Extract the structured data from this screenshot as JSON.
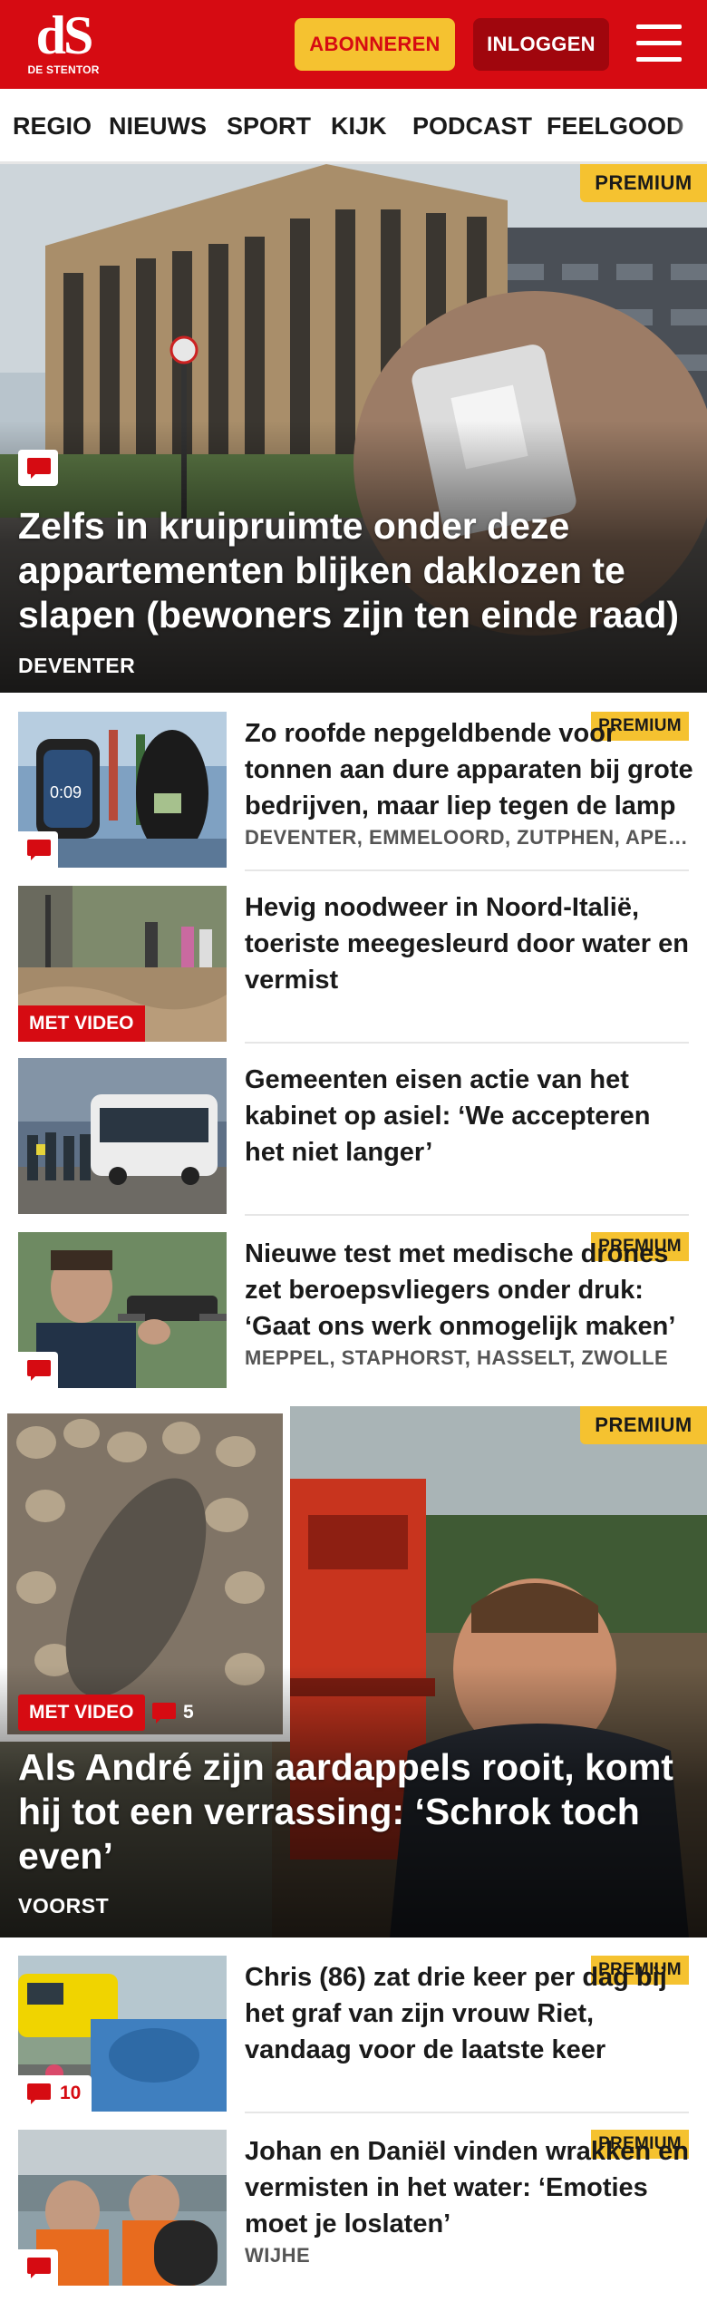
{
  "header": {
    "logo_mark": "dS",
    "logo_sub": "DE STENTOR",
    "subscribe_label": "ABONNEREN",
    "login_label": "INLOGGEN"
  },
  "nav": {
    "items": [
      "REGIO",
      "NIEUWS",
      "SPORT",
      "KIJK",
      "PODCAST",
      "FEELGOOD"
    ]
  },
  "labels": {
    "premium": "PREMIUM",
    "video": "MET VIDEO"
  },
  "hero1": {
    "title": "Zelfs in kruipruimte onder deze appartementen blijken daklozen te slapen (bewoners zijn ten einde raad)",
    "place": "DEVENTER"
  },
  "articles": [
    {
      "title": "Zo roofde nepgeldbende voor tonnen aan dure apparaten bij grote bedrijven, maar liep tegen de lamp",
      "place": "DEVENTER, EMMELOORD, ZUTPHEN, APELDOORN"
    },
    {
      "title": "Hevig noodweer in Noord-Italië, toeriste meegesleurd door water en vermist"
    },
    {
      "title": "Gemeenten eisen actie van het kabinet op asiel: ‘We accepteren het niet langer’"
    },
    {
      "title": "Nieuwe test met medische drones zet beroepsvliegers onder druk: ‘Gaat ons werk onmogelijk maken’",
      "place": "MEPPEL, STAPHORST, HASSELT, ZWOLLE"
    }
  ],
  "hero2": {
    "title": "Als André zijn aardappels rooit, komt hij tot een verrassing: ‘Schrok toch even’",
    "place": "VOORST",
    "comment_count": "5"
  },
  "articles2": [
    {
      "title": "Chris (86) zat drie keer per dag bij het graf van zijn vrouw Riet, vandaag voor de laatste keer",
      "comment_count": "10"
    },
    {
      "title": "Johan en Daniël vinden wrakken en vermisten in het water: ‘Emoties moet je loslaten’",
      "place": "WIJHE"
    }
  ],
  "colors": {
    "brand_red": "#d60b12",
    "premium_yellow": "#f5c230",
    "login_dark_red": "#a0060d"
  },
  "icons": [
    "menu-icon",
    "comment-icon"
  ]
}
